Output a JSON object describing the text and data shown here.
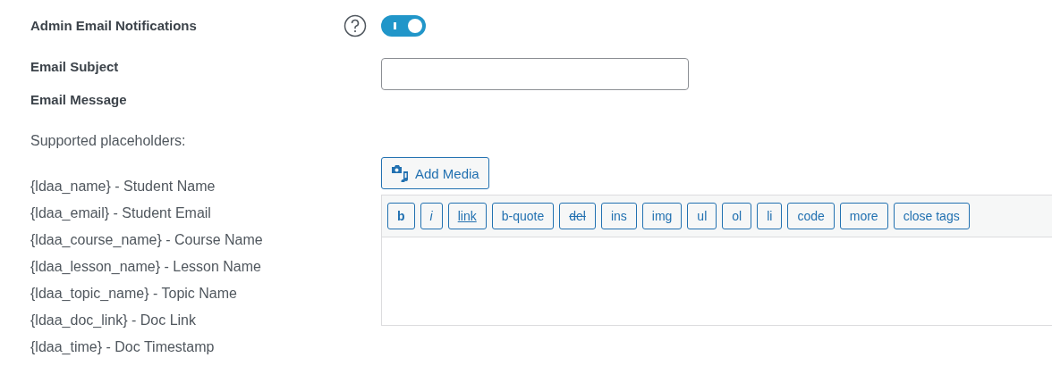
{
  "notifications": {
    "label": "Admin Email Notifications",
    "on": true
  },
  "subject": {
    "label": "Email Subject"
  },
  "message": {
    "label": "Email Message"
  },
  "placeholders": {
    "heading": "Supported placeholders:",
    "items": [
      "{ldaa_name} - Student Name",
      "{ldaa_email} - Student Email",
      "{ldaa_course_name} - Course Name",
      "{ldaa_lesson_name} - Lesson Name",
      "{ldaa_topic_name} - Topic Name",
      "{ldaa_doc_link} - Doc Link",
      "{ldaa_time} - Doc Timestamp"
    ]
  },
  "editor": {
    "add_media": "Add Media",
    "quicktags": [
      {
        "label": "b",
        "kind": "bold"
      },
      {
        "label": "i",
        "kind": "italic"
      },
      {
        "label": "link",
        "kind": "link"
      },
      {
        "label": "b-quote",
        "kind": "plain"
      },
      {
        "label": "del",
        "kind": "del"
      },
      {
        "label": "ins",
        "kind": "plain"
      },
      {
        "label": "img",
        "kind": "plain"
      },
      {
        "label": "ul",
        "kind": "plain"
      },
      {
        "label": "ol",
        "kind": "plain"
      },
      {
        "label": "li",
        "kind": "plain"
      },
      {
        "label": "code",
        "kind": "plain"
      },
      {
        "label": "more",
        "kind": "plain"
      },
      {
        "label": "close tags",
        "kind": "plain"
      }
    ]
  }
}
